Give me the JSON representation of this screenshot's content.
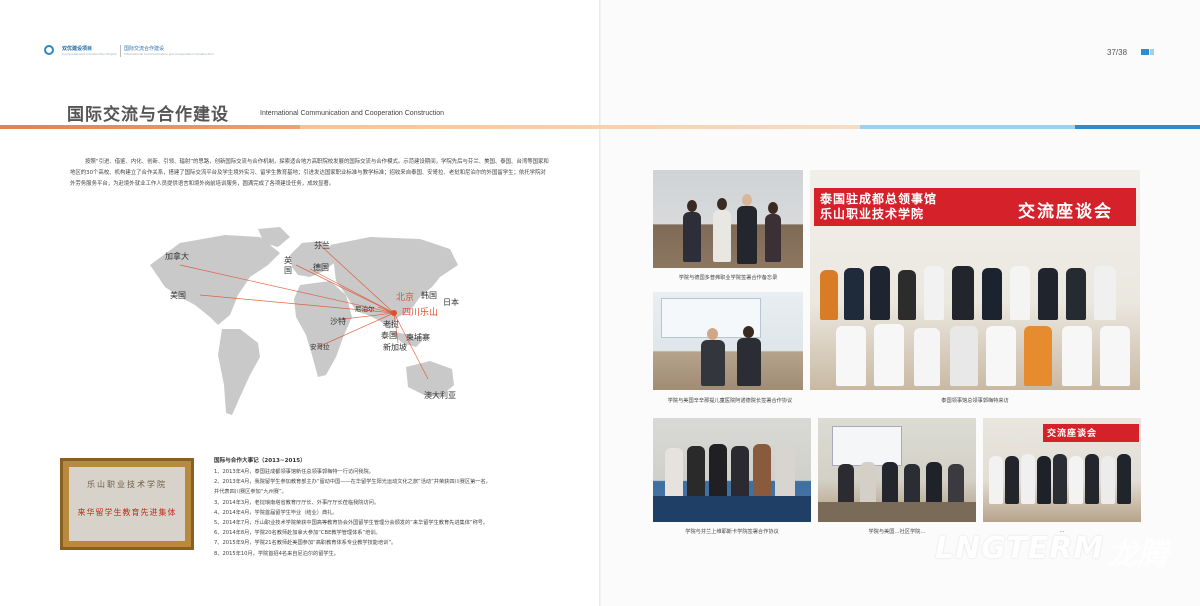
{
  "header": {
    "project_title": "双优建设项目",
    "project_title_en": "Comprehensive Construction Project",
    "section": "国际交流合作建设",
    "section_en": "International Communication and Cooperation Construction",
    "page_number": "37/38"
  },
  "left_page": {
    "title": "国际交流与合作建设",
    "title_en": "International Communication and Cooperation Construction",
    "intro": "按照“引进、借鉴、内化、创新、引领、辐射”的思路，创新国际交流与合作机制，探索适合地方高职院校发展的国际交流与合作模式。示范建设期间，学院先后与芬兰、美国、泰国、台湾等国家和地区的30个高校、机构建立了合作关系，搭建了国际交流平台及学生境外实习、留学生教育基地；引进发达国家职业标准与教学标准；招收来自泰国、安哥拉、老挝和尼泊尔的外国留学生；依托学院对外劳务服务平台，为赴境外就业工作人员提供语言和境外岗前培训服务，圆满完成了各项建设任务，成效显著。",
    "map_labels": {
      "canada": "加拿大",
      "usa": "美国",
      "uk": "英国",
      "finland": "芬兰",
      "germany": "德国",
      "nepal": "尼泊尔",
      "beijing": "北京",
      "korea": "韩国",
      "japan": "日本",
      "sichuan": "四川乐山",
      "saudi": "沙特",
      "laos": "老挝",
      "thailand": "泰国",
      "cambodia": "柬埔寨",
      "singapore": "新加坡",
      "angola": "安哥拉",
      "australia": "澳大利亚"
    },
    "award": {
      "line1": "乐山职业技术学院",
      "line2": "来华留学生教育先进集体"
    },
    "events_title": "国际与合作大事记（2013~2015）",
    "events": [
      "1、2013年4月，泰国驻成都领事馆新任总领事郭梅特一行访问我院。",
      "2、2013年4月，我院留学生参加教育部主办“留动中国——在华留学生阳光运动文化之旅”活动”并荣获四川赛区第一名，",
      "     并代表四川赛区参加“九州赛”。",
      "3、2014年3月，老挝琅南塔省教育厅厅长、外事厅厅长莅临我院访问。",
      "4、2014年4月，学院首届留学生毕业（结业）典礼。",
      "5、2014年7月，乐山职业技术学院荣获中国高等教育协会外国留学生管理分会颁发的“来华留学生教育先进集体”称号。",
      "6、2014年8月，学院20名教师赴加拿大参加“CBE教学管理体系”培训。",
      "7、2015年9月，学院21名教师赴美国参加“高职教育体系专业教学技能培训”。",
      "8、2015年10月，学院首招4名来自尼泊尔的留学生。"
    ]
  },
  "right_page": {
    "photos": [
      {
        "caption": "学院与德国多普弗职业学院签署合作备忘录"
      },
      {
        "caption": "学院与美国辛辛那提儿童医院阿诺德院长签署合作协议"
      },
      {
        "caption": "泰国领事馆总领事郭梅特来访",
        "banner_line1": "泰国驻成都总领事馆",
        "banner_line2": "乐山职业技术学院",
        "banner_right": "交流座谈会"
      },
      {
        "caption": "学院与芬兰上维耶斯卡学院签署合作协议"
      },
      {
        "caption": "学院与美国…社区学院…",
        "screen_text": ""
      },
      {
        "caption": "…",
        "banner": "交流座谈会"
      }
    ],
    "watermark": {
      "text": "LNGTERM",
      "cn": "龙腾"
    }
  },
  "colors": {
    "accent_orange": "#e8804a",
    "accent_blue": "#2c8ccf",
    "banner_red": "#d5222a"
  }
}
